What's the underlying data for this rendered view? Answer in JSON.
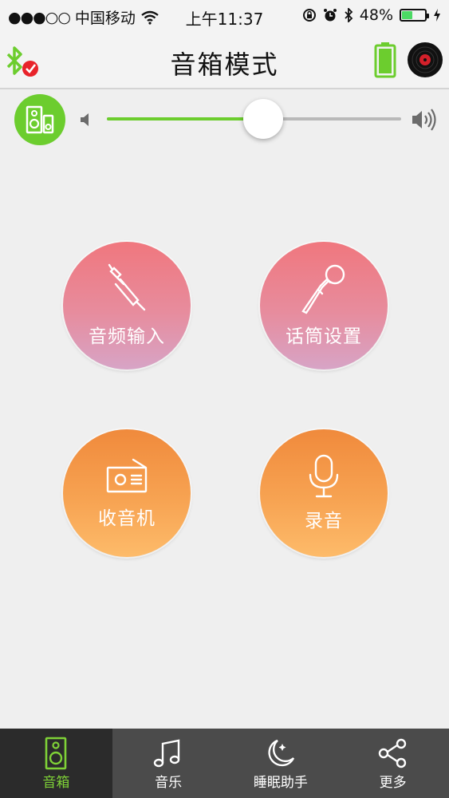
{
  "status_bar": {
    "carrier": "中国移动",
    "time": "上午11:37",
    "battery_percent": "48%",
    "battery_level": 0.48
  },
  "header": {
    "title": "音箱模式",
    "icons": [
      "bluetooth-connected-icon",
      "battery-icon",
      "vinyl-disc-icon"
    ]
  },
  "volume": {
    "level": 0.53,
    "icons": [
      "speaker-mode-icon",
      "volume-low-icon",
      "volume-high-icon"
    ]
  },
  "modes": [
    {
      "label": "音频输入",
      "icon": "audio-jack-icon",
      "color": "pink"
    },
    {
      "label": "话筒设置",
      "icon": "microphone-icon",
      "color": "pink"
    },
    {
      "label": "收音机",
      "icon": "radio-icon",
      "color": "orange"
    },
    {
      "label": "录音",
      "icon": "record-mic-icon",
      "color": "orange"
    }
  ],
  "tabs": [
    {
      "label": "音箱",
      "icon": "speaker-icon",
      "active": true
    },
    {
      "label": "音乐",
      "icon": "music-note-icon",
      "active": false
    },
    {
      "label": "睡眠助手",
      "icon": "moon-icon",
      "active": false
    },
    {
      "label": "更多",
      "icon": "share-icon",
      "active": false
    }
  ],
  "colors": {
    "accent_green": "#6ccd2e",
    "tab_active": "#7fd237",
    "pink_top": "#f0777e",
    "pink_bottom": "#d7a4c6",
    "orange_top": "#f08a3c",
    "orange_bottom": "#fdbb6a",
    "tab_bar": "#4b4b4b"
  }
}
